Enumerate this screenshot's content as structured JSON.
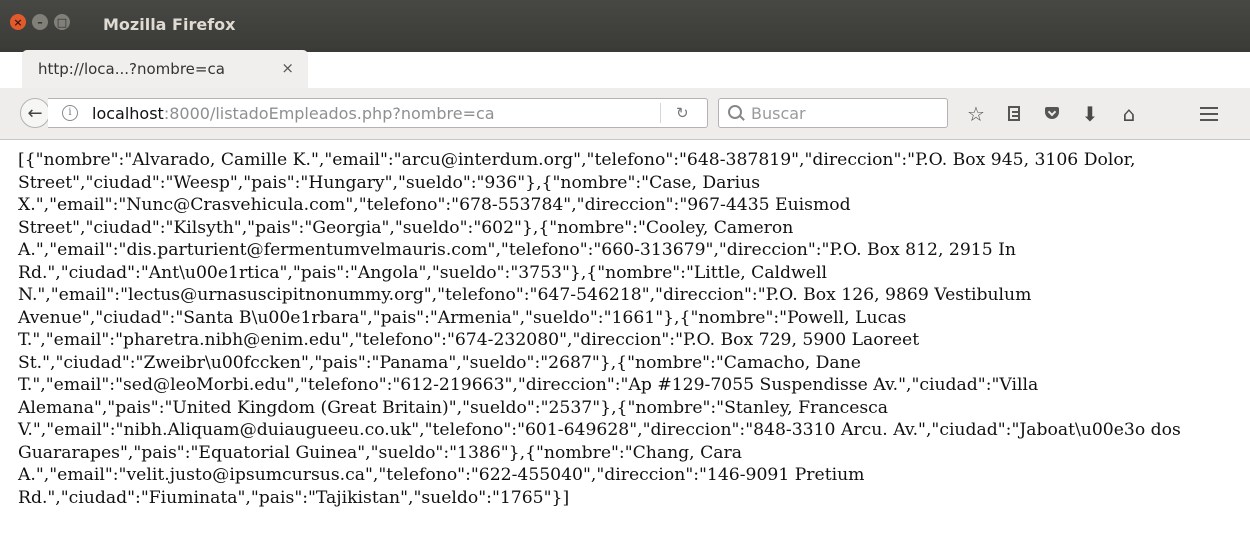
{
  "window": {
    "title": "Mozilla Firefox",
    "buttons": {
      "close": "×",
      "minimize": "–",
      "maximize": "□"
    }
  },
  "tab": {
    "title": "http://loca...?nombre=ca",
    "close_label": "×",
    "new_tab_label": "+"
  },
  "navbar": {
    "url_host": "localhost",
    "url_rest": ":8000/listadoEmpleados.php?nombre=ca",
    "info_label": "i",
    "reload_label": "C",
    "search_placeholder": "Buscar",
    "icons": [
      "bookmark-star-icon",
      "reader-list-icon",
      "pocket-icon",
      "download-icon",
      "home-icon",
      "menu-icon"
    ]
  },
  "page": {
    "body_text": "[{\"nombre\":\"Alvarado, Camille K.\",\"email\":\"arcu@interdum.org\",\"telefono\":\"648-387819\",\"direccion\":\"P.O. Box 945, 3106 Dolor, Street\",\"ciudad\":\"Weesp\",\"pais\":\"Hungary\",\"sueldo\":\"936\"},{\"nombre\":\"Case, Darius X.\",\"email\":\"Nunc@Crasvehicula.com\",\"telefono\":\"678-553784\",\"direccion\":\"967-4435 Euismod Street\",\"ciudad\":\"Kilsyth\",\"pais\":\"Georgia\",\"sueldo\":\"602\"},{\"nombre\":\"Cooley, Cameron A.\",\"email\":\"dis.parturient@fermentumvelmauris.com\",\"telefono\":\"660-313679\",\"direccion\":\"P.O. Box 812, 2915 In Rd.\",\"ciudad\":\"Ant\\u00e1rtica\",\"pais\":\"Angola\",\"sueldo\":\"3753\"},{\"nombre\":\"Little, Caldwell N.\",\"email\":\"lectus@urnasuscipitnonummy.org\",\"telefono\":\"647-546218\",\"direccion\":\"P.O. Box 126, 9869 Vestibulum Avenue\",\"ciudad\":\"Santa B\\u00e1rbara\",\"pais\":\"Armenia\",\"sueldo\":\"1661\"},{\"nombre\":\"Powell, Lucas T.\",\"email\":\"pharetra.nibh@enim.edu\",\"telefono\":\"674-232080\",\"direccion\":\"P.O. Box 729, 5900 Laoreet St.\",\"ciudad\":\"Zweibr\\u00fccken\",\"pais\":\"Panama\",\"sueldo\":\"2687\"},{\"nombre\":\"Camacho, Dane T.\",\"email\":\"sed@leoMorbi.edu\",\"telefono\":\"612-219663\",\"direccion\":\"Ap #129-7055 Suspendisse Av.\",\"ciudad\":\"Villa Alemana\",\"pais\":\"United Kingdom (Great Britain)\",\"sueldo\":\"2537\"},{\"nombre\":\"Stanley, Francesca V.\",\"email\":\"nibh.Aliquam@duiaugueeu.co.uk\",\"telefono\":\"601-649628\",\"direccion\":\"848-3310 Arcu. Av.\",\"ciudad\":\"Jaboat\\u00e3o dos Guararapes\",\"pais\":\"Equatorial Guinea\",\"sueldo\":\"1386\"},{\"nombre\":\"Chang, Cara A.\",\"email\":\"velit.justo@ipsumcursus.ca\",\"telefono\":\"622-455040\",\"direccion\":\"146-9091 Pretium Rd.\",\"ciudad\":\"Fiuminata\",\"pais\":\"Tajikistan\",\"sueldo\":\"1765\"}]"
  }
}
